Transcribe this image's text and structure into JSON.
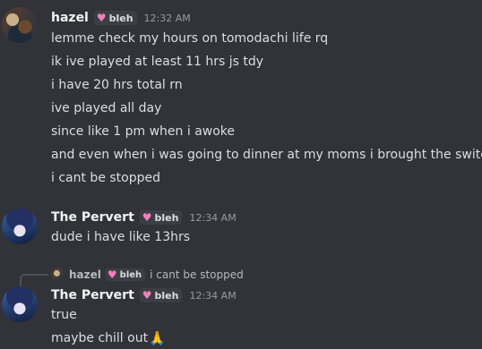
{
  "messages": [
    {
      "author": "hazel",
      "tag": "bleh",
      "time": "12:32 AM",
      "lines": [
        "lemme check my hours on tomodachi life rq",
        "ik ive played at least 11 hrs js tdy",
        "i have 20 hrs total rn",
        "ive played all day",
        "since like 1 pm when i awoke",
        "and even when i was going to dinner at my moms i brought the switch",
        "i cant be stopped"
      ]
    },
    {
      "author": "The Pervert",
      "tag": "bleh",
      "time": "12:34 AM",
      "lines": [
        "dude i have like 13hrs"
      ]
    },
    {
      "reply": {
        "author": "hazel",
        "tag": "bleh",
        "text": "i cant be stopped"
      },
      "author": "The Pervert",
      "tag": "bleh",
      "time": "12:34 AM",
      "lines": [
        "true",
        "maybe chill out"
      ],
      "emoji": "🙏"
    }
  ],
  "icons": {
    "tag_icon": "heart-icon",
    "emoji": "folded-hands-emoji"
  },
  "colors": {
    "tag_heart": "#f47fba",
    "background": "#313338",
    "timestamp": "#949ba4"
  }
}
